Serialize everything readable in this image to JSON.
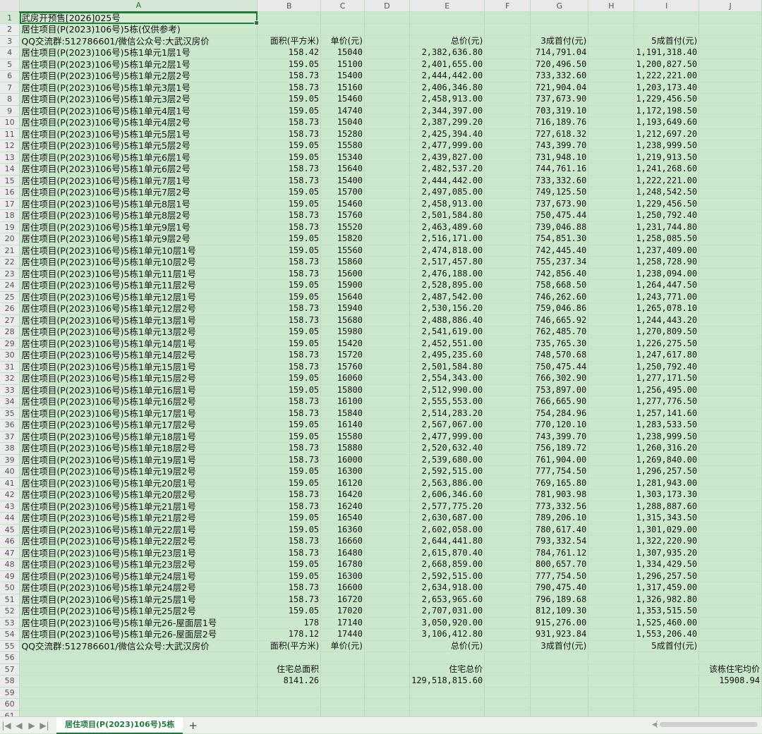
{
  "columns": [
    "A",
    "B",
    "C",
    "D",
    "E",
    "F",
    "G",
    "H",
    "I",
    "J"
  ],
  "row_count": 65,
  "title_rows": {
    "r1": "武房开预售[2026]025号",
    "r2": "居住项目(P(2023)106号)5栋(仅供参考)"
  },
  "header_rows": {
    "r3": {
      "a": "QQ交流群:512786601/微信公众号:大武汉房价",
      "b": "面积(平方米)",
      "c": "单价(元)",
      "e": "总价(元)",
      "g": "3成首付(元)",
      "i": "5成首付(元)"
    },
    "r55": {
      "a": "QQ交流群:512786601/微信公众号:大武汉房价",
      "b": "面积(平方米)",
      "c": "单价(元)",
      "e": "总价(元)",
      "g": "3成首付(元)",
      "i": "5成首付(元)"
    }
  },
  "data_rows": [
    [
      "居住项目(P(2023)106号)5栋1单元1层1号",
      "158.42",
      "15040",
      "2,382,636.80",
      "714,791.04",
      "1,191,318.40"
    ],
    [
      "居住项目(P(2023)106号)5栋1单元2层1号",
      "159.05",
      "15100",
      "2,401,655.00",
      "720,496.50",
      "1,200,827.50"
    ],
    [
      "居住项目(P(2023)106号)5栋1单元2层2号",
      "158.73",
      "15400",
      "2,444,442.00",
      "733,332.60",
      "1,222,221.00"
    ],
    [
      "居住项目(P(2023)106号)5栋1单元3层1号",
      "158.73",
      "15160",
      "2,406,346.80",
      "721,904.04",
      "1,203,173.40"
    ],
    [
      "居住项目(P(2023)106号)5栋1单元3层2号",
      "159.05",
      "15460",
      "2,458,913.00",
      "737,673.90",
      "1,229,456.50"
    ],
    [
      "居住项目(P(2023)106号)5栋1单元4层1号",
      "159.05",
      "14740",
      "2,344,397.00",
      "703,319.10",
      "1,172,198.50"
    ],
    [
      "居住项目(P(2023)106号)5栋1单元4层2号",
      "158.73",
      "15040",
      "2,387,299.20",
      "716,189.76",
      "1,193,649.60"
    ],
    [
      "居住项目(P(2023)106号)5栋1单元5层1号",
      "158.73",
      "15280",
      "2,425,394.40",
      "727,618.32",
      "1,212,697.20"
    ],
    [
      "居住项目(P(2023)106号)5栋1单元5层2号",
      "159.05",
      "15580",
      "2,477,999.00",
      "743,399.70",
      "1,238,999.50"
    ],
    [
      "居住项目(P(2023)106号)5栋1单元6层1号",
      "159.05",
      "15340",
      "2,439,827.00",
      "731,948.10",
      "1,219,913.50"
    ],
    [
      "居住项目(P(2023)106号)5栋1单元6层2号",
      "158.73",
      "15640",
      "2,482,537.20",
      "744,761.16",
      "1,241,268.60"
    ],
    [
      "居住项目(P(2023)106号)5栋1单元7层1号",
      "158.73",
      "15400",
      "2,444,442.00",
      "733,332.60",
      "1,222,221.00"
    ],
    [
      "居住项目(P(2023)106号)5栋1单元7层2号",
      "159.05",
      "15700",
      "2,497,085.00",
      "749,125.50",
      "1,248,542.50"
    ],
    [
      "居住项目(P(2023)106号)5栋1单元8层1号",
      "159.05",
      "15460",
      "2,458,913.00",
      "737,673.90",
      "1,229,456.50"
    ],
    [
      "居住项目(P(2023)106号)5栋1单元8层2号",
      "158.73",
      "15760",
      "2,501,584.80",
      "750,475.44",
      "1,250,792.40"
    ],
    [
      "居住项目(P(2023)106号)5栋1单元9层1号",
      "158.73",
      "15520",
      "2,463,489.60",
      "739,046.88",
      "1,231,744.80"
    ],
    [
      "居住项目(P(2023)106号)5栋1单元9层2号",
      "159.05",
      "15820",
      "2,516,171.00",
      "754,851.30",
      "1,258,085.50"
    ],
    [
      "居住项目(P(2023)106号)5栋1单元10层1号",
      "159.05",
      "15560",
      "2,474,818.00",
      "742,445.40",
      "1,237,409.00"
    ],
    [
      "居住项目(P(2023)106号)5栋1单元10层2号",
      "158.73",
      "15860",
      "2,517,457.80",
      "755,237.34",
      "1,258,728.90"
    ],
    [
      "居住项目(P(2023)106号)5栋1单元11层1号",
      "158.73",
      "15600",
      "2,476,188.00",
      "742,856.40",
      "1,238,094.00"
    ],
    [
      "居住项目(P(2023)106号)5栋1单元11层2号",
      "159.05",
      "15900",
      "2,528,895.00",
      "758,668.50",
      "1,264,447.50"
    ],
    [
      "居住项目(P(2023)106号)5栋1单元12层1号",
      "159.05",
      "15640",
      "2,487,542.00",
      "746,262.60",
      "1,243,771.00"
    ],
    [
      "居住项目(P(2023)106号)5栋1单元12层2号",
      "158.73",
      "15940",
      "2,530,156.20",
      "759,046.86",
      "1,265,078.10"
    ],
    [
      "居住项目(P(2023)106号)5栋1单元13层1号",
      "158.73",
      "15680",
      "2,488,886.40",
      "746,665.92",
      "1,244,443.20"
    ],
    [
      "居住项目(P(2023)106号)5栋1单元13层2号",
      "159.05",
      "15980",
      "2,541,619.00",
      "762,485.70",
      "1,270,809.50"
    ],
    [
      "居住项目(P(2023)106号)5栋1单元14层1号",
      "159.05",
      "15420",
      "2,452,551.00",
      "735,765.30",
      "1,226,275.50"
    ],
    [
      "居住项目(P(2023)106号)5栋1单元14层2号",
      "158.73",
      "15720",
      "2,495,235.60",
      "748,570.68",
      "1,247,617.80"
    ],
    [
      "居住项目(P(2023)106号)5栋1单元15层1号",
      "158.73",
      "15760",
      "2,501,584.80",
      "750,475.44",
      "1,250,792.40"
    ],
    [
      "居住项目(P(2023)106号)5栋1单元15层2号",
      "159.05",
      "16060",
      "2,554,343.00",
      "766,302.90",
      "1,277,171.50"
    ],
    [
      "居住项目(P(2023)106号)5栋1单元16层1号",
      "159.05",
      "15800",
      "2,512,990.00",
      "753,897.00",
      "1,256,495.00"
    ],
    [
      "居住项目(P(2023)106号)5栋1单元16层2号",
      "158.73",
      "16100",
      "2,555,553.00",
      "766,665.90",
      "1,277,776.50"
    ],
    [
      "居住项目(P(2023)106号)5栋1单元17层1号",
      "158.73",
      "15840",
      "2,514,283.20",
      "754,284.96",
      "1,257,141.60"
    ],
    [
      "居住项目(P(2023)106号)5栋1单元17层2号",
      "159.05",
      "16140",
      "2,567,067.00",
      "770,120.10",
      "1,283,533.50"
    ],
    [
      "居住项目(P(2023)106号)5栋1单元18层1号",
      "159.05",
      "15580",
      "2,477,999.00",
      "743,399.70",
      "1,238,999.50"
    ],
    [
      "居住项目(P(2023)106号)5栋1单元18层2号",
      "158.73",
      "15880",
      "2,520,632.40",
      "756,189.72",
      "1,260,316.20"
    ],
    [
      "居住项目(P(2023)106号)5栋1单元19层1号",
      "158.73",
      "16000",
      "2,539,680.00",
      "761,904.00",
      "1,269,840.00"
    ],
    [
      "居住项目(P(2023)106号)5栋1单元19层2号",
      "159.05",
      "16300",
      "2,592,515.00",
      "777,754.50",
      "1,296,257.50"
    ],
    [
      "居住项目(P(2023)106号)5栋1单元20层1号",
      "159.05",
      "16120",
      "2,563,886.00",
      "769,165.80",
      "1,281,943.00"
    ],
    [
      "居住项目(P(2023)106号)5栋1单元20层2号",
      "158.73",
      "16420",
      "2,606,346.60",
      "781,903.98",
      "1,303,173.30"
    ],
    [
      "居住项目(P(2023)106号)5栋1单元21层1号",
      "158.73",
      "16240",
      "2,577,775.20",
      "773,332.56",
      "1,288,887.60"
    ],
    [
      "居住项目(P(2023)106号)5栋1单元21层2号",
      "159.05",
      "16540",
      "2,630,687.00",
      "789,206.10",
      "1,315,343.50"
    ],
    [
      "居住项目(P(2023)106号)5栋1单元22层1号",
      "159.05",
      "16360",
      "2,602,058.00",
      "780,617.40",
      "1,301,029.00"
    ],
    [
      "居住项目(P(2023)106号)5栋1单元22层2号",
      "158.73",
      "16660",
      "2,644,441.80",
      "793,332.54",
      "1,322,220.90"
    ],
    [
      "居住项目(P(2023)106号)5栋1单元23层1号",
      "158.73",
      "16480",
      "2,615,870.40",
      "784,761.12",
      "1,307,935.20"
    ],
    [
      "居住项目(P(2023)106号)5栋1单元23层2号",
      "159.05",
      "16780",
      "2,668,859.00",
      "800,657.70",
      "1,334,429.50"
    ],
    [
      "居住项目(P(2023)106号)5栋1单元24层1号",
      "159.05",
      "16300",
      "2,592,515.00",
      "777,754.50",
      "1,296,257.50"
    ],
    [
      "居住项目(P(2023)106号)5栋1单元24层2号",
      "158.73",
      "16600",
      "2,634,918.00",
      "790,475.40",
      "1,317,459.00"
    ],
    [
      "居住项目(P(2023)106号)5栋1单元25层1号",
      "158.73",
      "16720",
      "2,653,965.60",
      "796,189.68",
      "1,326,982.80"
    ],
    [
      "居住项目(P(2023)106号)5栋1单元25层2号",
      "159.05",
      "17020",
      "2,707,031.00",
      "812,109.30",
      "1,353,515.50"
    ],
    [
      "居住项目(P(2023)106号)5栋1单元26-屋面层1号",
      "178",
      "17140",
      "3,050,920.00",
      "915,276.00",
      "1,525,460.00"
    ],
    [
      "居住项目(P(2023)106号)5栋1单元26-屋面层2号",
      "178.12",
      "17440",
      "3,106,412.80",
      "931,923.84",
      "1,553,206.40"
    ]
  ],
  "summary": {
    "r57": {
      "b": "住宅总面积",
      "e": "住宅总价",
      "j": "该栋住宅均价"
    },
    "r58": {
      "b": "8141.26",
      "e": "129,518,815.60",
      "j": "15908.94"
    }
  },
  "sheet_tab": {
    "label": "居住项目(P(2023)106号)5栋",
    "add_label": "+"
  },
  "nav_icons": [
    "first-sheet-icon",
    "prev-sheet-icon",
    "next-sheet-icon",
    "last-sheet-icon"
  ],
  "nav_glyphs": [
    "|◀",
    "◀",
    "▶",
    "▶|"
  ],
  "colors": {
    "sheet_bg": "#cce8cc",
    "accent": "#1f7a3a"
  }
}
